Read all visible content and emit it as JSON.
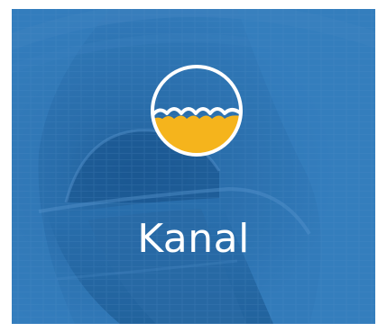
{
  "tile": {
    "title": "Kanal",
    "background_color": "#2a74b2",
    "logo_icon": "water-waves-circle-icon",
    "logo_fill_color": "#f5b41c",
    "logo_line_color": "#ffffff"
  }
}
